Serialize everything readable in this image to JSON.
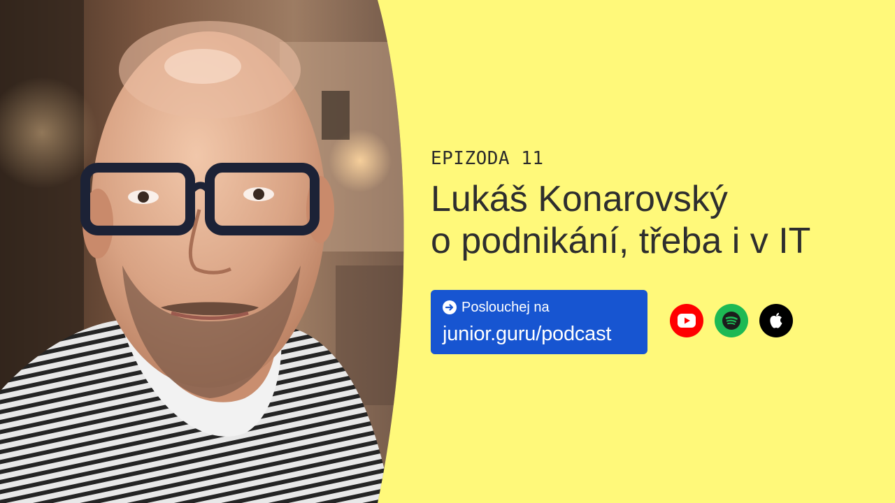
{
  "episode": {
    "label": "EPIZODA 11"
  },
  "title": {
    "line1": "Lukáš Konarovský",
    "line2": "o podnikání, třeba i v IT"
  },
  "cta": {
    "prefix": "Poslouchej na",
    "url": "junior.guru/podcast",
    "icon": "arrow-right-circle-icon"
  },
  "platforms": [
    {
      "name": "YouTube",
      "icon": "youtube-icon",
      "color": "#FF0000"
    },
    {
      "name": "Spotify",
      "icon": "spotify-icon",
      "color": "#1DB954"
    },
    {
      "name": "Apple Podcasts",
      "icon": "apple-icon",
      "color": "#000000"
    }
  ],
  "colors": {
    "background": "#FFF97A",
    "button": "#1755D1",
    "text": "#2E2E2E"
  }
}
